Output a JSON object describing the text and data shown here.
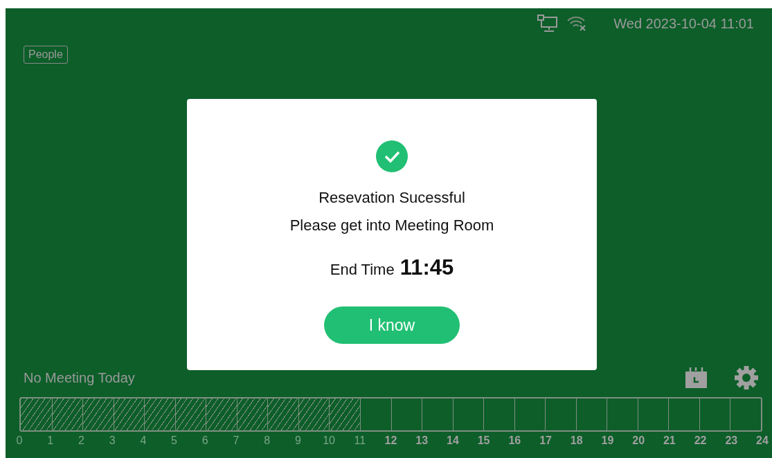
{
  "status_bar": {
    "datetime": "Wed 2023-10-04 11:01"
  },
  "tag": "People",
  "schedule_status": "No Meeting Today",
  "timeline": {
    "slots": [
      {
        "past": true
      },
      {
        "past": true
      },
      {
        "past": true
      },
      {
        "past": true
      },
      {
        "past": true
      },
      {
        "past": true
      },
      {
        "past": true
      },
      {
        "past": true
      },
      {
        "past": true
      },
      {
        "past": true
      },
      {
        "past": true
      },
      {
        "past": false
      },
      {
        "past": false
      },
      {
        "past": false
      },
      {
        "past": false
      },
      {
        "past": false
      },
      {
        "past": false
      },
      {
        "past": false
      },
      {
        "past": false
      },
      {
        "past": false
      },
      {
        "past": false
      },
      {
        "past": false
      },
      {
        "past": false
      },
      {
        "past": false
      }
    ],
    "labels": [
      {
        "label": "0",
        "past": true
      },
      {
        "label": "1",
        "past": true
      },
      {
        "label": "2",
        "past": true
      },
      {
        "label": "3",
        "past": true
      },
      {
        "label": "4",
        "past": true
      },
      {
        "label": "5",
        "past": true
      },
      {
        "label": "6",
        "past": true
      },
      {
        "label": "7",
        "past": true
      },
      {
        "label": "8",
        "past": true
      },
      {
        "label": "9",
        "past": true
      },
      {
        "label": "10",
        "past": true
      },
      {
        "label": "11",
        "past": true
      },
      {
        "label": "12",
        "past": false
      },
      {
        "label": "13",
        "past": false
      },
      {
        "label": "14",
        "past": false
      },
      {
        "label": "15",
        "past": false
      },
      {
        "label": "16",
        "past": false
      },
      {
        "label": "17",
        "past": false
      },
      {
        "label": "18",
        "past": false
      },
      {
        "label": "19",
        "past": false
      },
      {
        "label": "20",
        "past": false
      },
      {
        "label": "21",
        "past": false
      },
      {
        "label": "22",
        "past": false
      },
      {
        "label": "23",
        "past": false
      },
      {
        "label": "24",
        "past": false
      }
    ]
  },
  "dialog": {
    "title": "Resevation Sucessful",
    "message": "Please get into Meeting Room",
    "end_time_label": "End Time",
    "end_time": "11:45",
    "button": "I know"
  }
}
